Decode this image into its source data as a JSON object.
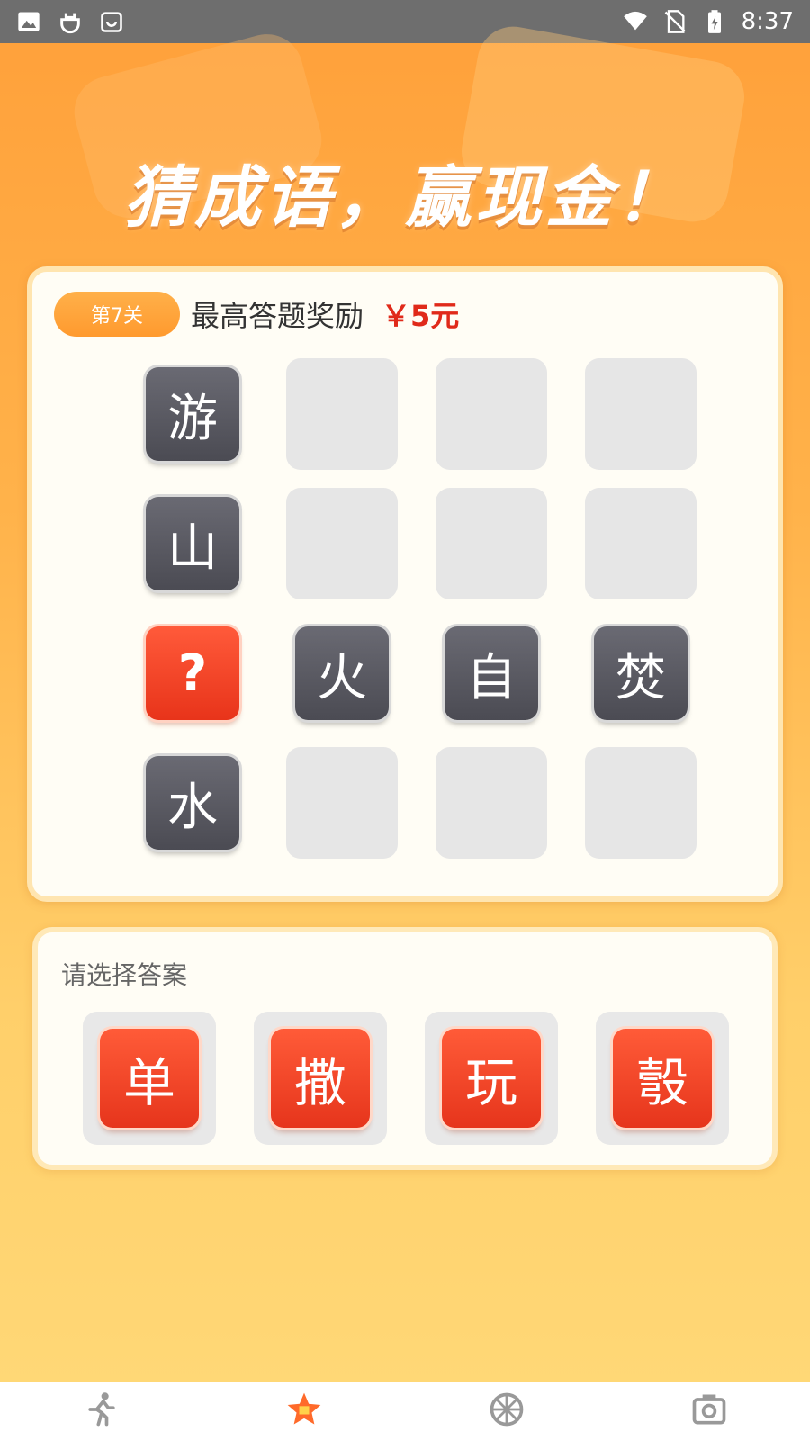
{
  "status_bar": {
    "time": "8:37",
    "left_icons": [
      "image-icon",
      "bug-icon",
      "shopping-bag-icon"
    ],
    "right_icons": [
      "wifi-icon",
      "no-sim-icon",
      "battery-charging-icon"
    ]
  },
  "header": {
    "title": "猜成语，赢现金！"
  },
  "puzzle": {
    "level_badge": "第7关",
    "reward_label": "最高答题奖励",
    "reward_value": "￥5元",
    "grid": [
      [
        "游",
        "",
        "",
        ""
      ],
      [
        "山",
        "",
        "",
        ""
      ],
      [
        "?",
        "火",
        "自",
        "焚"
      ],
      [
        "水",
        "",
        "",
        ""
      ]
    ]
  },
  "answers": {
    "title": "请选择答案",
    "options": [
      "单",
      "撒",
      "玩",
      "彀"
    ]
  },
  "bottom_nav": {
    "items": [
      "running-man-icon",
      "star-badge-icon",
      "wheel-icon",
      "camera-icon"
    ],
    "active_index": 1
  },
  "colors": {
    "accent_orange": "#ff9a2e",
    "tile_red": "#e8341a",
    "tile_dark": "#4b4b53",
    "reward_red": "#e02a1a"
  }
}
